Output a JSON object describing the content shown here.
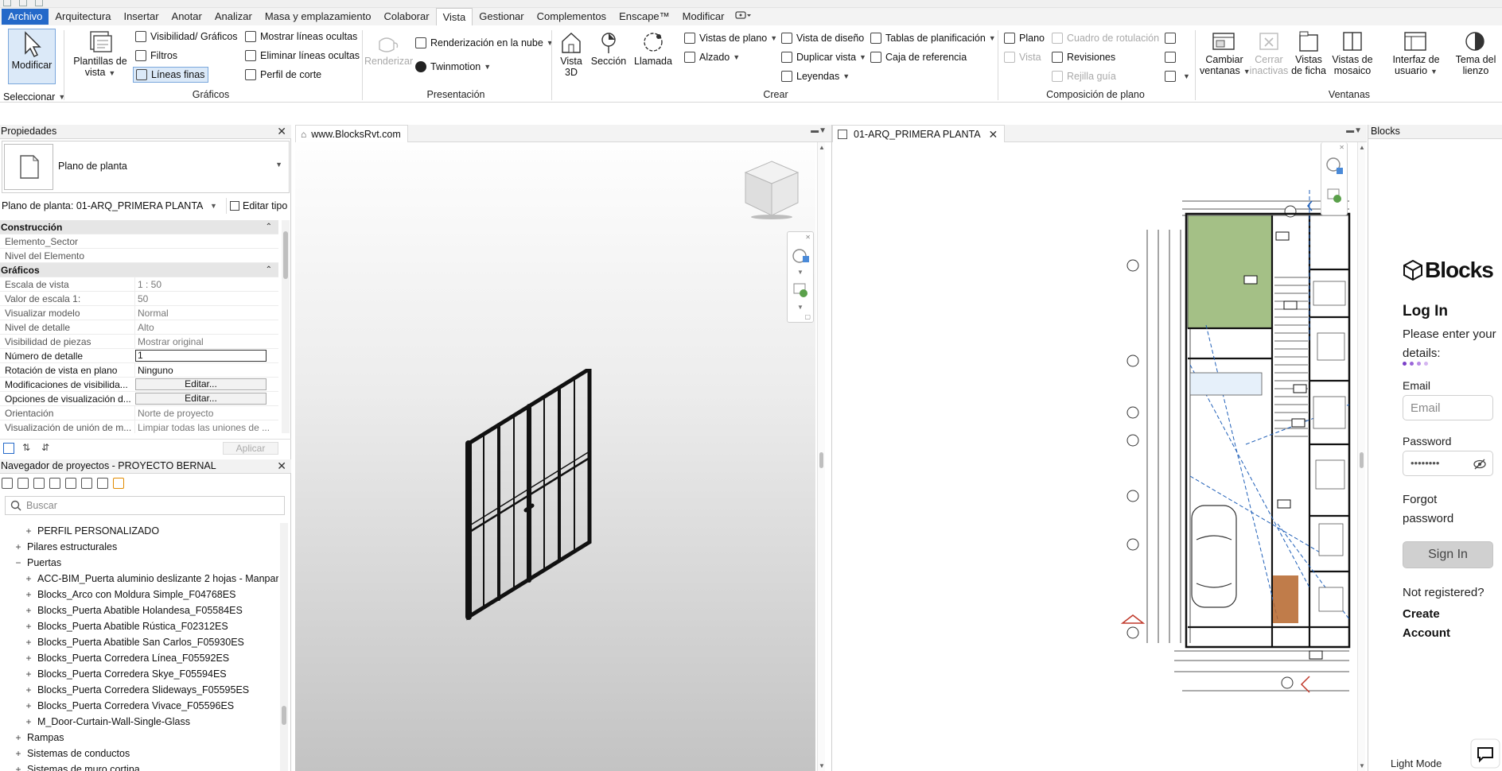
{
  "menu": {
    "items": [
      "Archivo",
      "Arquitectura",
      "Insertar",
      "Anotar",
      "Analizar",
      "Masa y emplazamiento",
      "Colaborar",
      "Vista",
      "Gestionar",
      "Complementos",
      "Enscape™",
      "Modificar"
    ],
    "active": "Vista"
  },
  "ribbon": {
    "modificar": "Modificar",
    "seleccionar": "Seleccionar",
    "plantillas": "Plantillas de vista",
    "visibilidad": "Visibilidad/ Gráficos",
    "filtros": "Filtros",
    "lineas_finas": "Líneas finas",
    "mostrar_lineas": "Mostrar líneas ocultas",
    "eliminar_lineas": "Eliminar líneas ocultas",
    "perfil_corte": "Perfil de corte",
    "graficos_title": "Gráficos",
    "renderizar": "Renderizar",
    "renderizacion_nube": "Renderización en la nube",
    "twinmotion": "Twinmotion",
    "presentacion_title": "Presentación",
    "vista3d": "Vista 3D",
    "seccion": "Sección",
    "llamada": "Llamada",
    "vistas_plano": "Vistas de plano",
    "alzado": "Alzado",
    "vista_diseno": "Vista de diseño",
    "duplicar_vista": "Duplicar vista",
    "leyendas": "Leyendas",
    "tablas_planificacion": "Tablas de planificación",
    "caja_referencia": "Caja de referencia",
    "crear_title": "Crear",
    "plano": "Plano",
    "vista": "Vista",
    "cuadro_rotulacion": "Cuadro de rotulación",
    "revisiones": "Revisiones",
    "rejilla_guia": "Rejilla guía",
    "composicion_title": "Composición de plano",
    "cambiar_ventanas": "Cambiar ventanas",
    "cerrar_inactivas": "Cerrar inactivas",
    "vistas_ficha": "Vistas de ficha",
    "vistas_mosaico": "Vistas de mosaico",
    "ventanas_title": "Ventanas",
    "interfaz_usuario": "Interfaz de usuario",
    "tema_lienzo": "Tema del lienzo"
  },
  "properties": {
    "title": "Propiedades",
    "type_name": "Plano de planta",
    "instance": "Plano de planta: 01-ARQ_PRIMERA PLANTA",
    "editar_tipo": "Editar tipo",
    "rows": [
      {
        "cat": true,
        "k": "Construcción"
      },
      {
        "k": "Elemento_Sector",
        "v": ""
      },
      {
        "k": "Nivel del Elemento",
        "v": ""
      },
      {
        "cat": true,
        "k": "Gráficos"
      },
      {
        "k": "Escala de vista",
        "v": "1 : 50"
      },
      {
        "k": "Valor de escala    1:",
        "v": "50"
      },
      {
        "k": "Visualizar modelo",
        "v": "Normal"
      },
      {
        "k": "Nivel de detalle",
        "v": "Alto"
      },
      {
        "k": "Visibilidad de piezas",
        "v": "Mostrar original"
      },
      {
        "k": "Número de detalle",
        "v": "1",
        "input": true,
        "edit": true
      },
      {
        "k": "Rotación de vista en plano",
        "v": "Ninguno",
        "edit": true
      },
      {
        "k": "Modificaciones de visibilida...",
        "v": "Editar...",
        "button": true,
        "edit": true
      },
      {
        "k": "Opciones de visualización d...",
        "v": "Editar...",
        "button": true,
        "edit": true
      },
      {
        "k": "Orientación",
        "v": "Norte de proyecto"
      },
      {
        "k": "Visualización de unión de m...",
        "v": "Limpiar todas las uniones de ..."
      }
    ],
    "aplicar": "Aplicar"
  },
  "navigator": {
    "title": "Navegador de proyectos - PROYECTO BERNAL",
    "search_placeholder": "Buscar",
    "items": [
      {
        "level": 2,
        "exp": "+",
        "label": "PERFIL PERSONALIZADO"
      },
      {
        "level": 1,
        "exp": "+",
        "label": "Pilares estructurales"
      },
      {
        "level": 1,
        "exp": "−",
        "label": "Puertas"
      },
      {
        "level": 2,
        "exp": "+",
        "label": "ACC-BIM_Puerta aluminio deslizante 2 hojas - Manpara"
      },
      {
        "level": 2,
        "exp": "+",
        "label": "Blocks_Arco con Moldura Simple_F04768ES"
      },
      {
        "level": 2,
        "exp": "+",
        "label": "Blocks_Puerta Abatible Holandesa_F05584ES"
      },
      {
        "level": 2,
        "exp": "+",
        "label": "Blocks_Puerta Abatible Rústica_F02312ES"
      },
      {
        "level": 2,
        "exp": "+",
        "label": "Blocks_Puerta Abatible San Carlos_F05930ES"
      },
      {
        "level": 2,
        "exp": "+",
        "label": "Blocks_Puerta Corredera Línea_F05592ES"
      },
      {
        "level": 2,
        "exp": "+",
        "label": "Blocks_Puerta Corredera Skye_F05594ES"
      },
      {
        "level": 2,
        "exp": "+",
        "label": "Blocks_Puerta Corredera Slideways_F05595ES"
      },
      {
        "level": 2,
        "exp": "+",
        "label": "Blocks_Puerta Corredera Vivace_F05596ES"
      },
      {
        "level": 2,
        "exp": "+",
        "label": "M_Door-Curtain-Wall-Single-Glass"
      },
      {
        "level": 1,
        "exp": "+",
        "label": "Rampas"
      },
      {
        "level": 1,
        "exp": "+",
        "label": "Sistemas de conductos"
      },
      {
        "level": 1,
        "exp": "+",
        "label": "Sistemas de muro cortina"
      }
    ]
  },
  "views": {
    "view1_tab": "www.BlocksRvt.com",
    "view2_tab": "01-ARQ_PRIMERA PLANTA"
  },
  "blocks": {
    "panel_title": "Blocks",
    "logo": "Blocks",
    "login_title": "Log In",
    "login_sub": "Please enter your details:",
    "email_label": "Email",
    "email_placeholder": "Email",
    "password_label": "Password",
    "password_value": "••••••••",
    "forgot": "Forgot password",
    "signin": "Sign In",
    "not_registered": "Not registered?",
    "create": "Create Account",
    "light_mode": "Light Mode"
  },
  "colors": {
    "accent": "#2469c9",
    "selection": "#dbe9f8",
    "plan_green": "#a4c086",
    "plan_blue": "#1f5fb8"
  }
}
